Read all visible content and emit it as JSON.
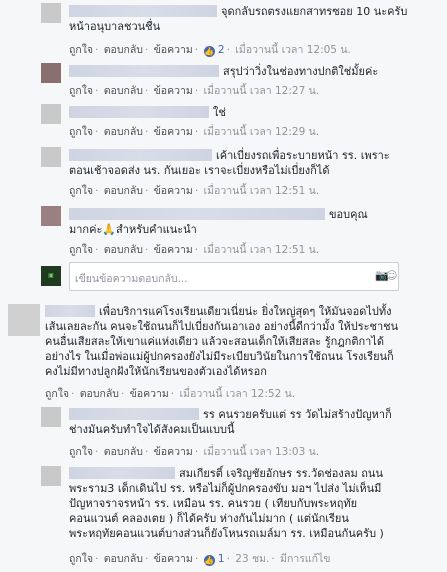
{
  "comments": [
    {
      "line1": "จุดกลับรถตรงแยกสาทรซอย 10 นะครับ",
      "line2": "หน้าอนุบาลชวนชื่น",
      "time": "เมื่อวานนี้ เวลา 12:05 น.",
      "likes": "2"
    },
    {
      "line1": "สรุปว่าวิ่งในช่องทางปกติใช่มั้ยค่ะ",
      "time": "เมื่อวานนี้ เวลา 12:27 น."
    },
    {
      "line1": "ใช่",
      "time": "เมื่อวานนี้ เวลา 12:29 น."
    },
    {
      "line1": "เค้าเบี่ยงรถเพื่อระบายหน้า รร. เพราะ",
      "line2": "ตอนเช้าจอดส่ง นร. กันเยอะ เราจะเบี่ยงหรือไม่เบี่ยงก็ได้",
      "time": "เมื่อวานนี้ เวลา 12:51 น."
    },
    {
      "line1": "ขอบคุณ",
      "line2": "มากค่ะ🙏สำหรับคำแนะนำ",
      "time": "เมื่อวานนี้ เวลา 12:51 น."
    }
  ],
  "composer": {
    "placeholder": "เขียนข้อความตอบกลับ..."
  },
  "main_comment": {
    "lines": [
      "เพื่อบริการแค่โรงเรียนเดียวเนี่ยน่ะ ยิ่งใหญ่สุดๆ ให้มันจอดไปทั้ง",
      "เส้นเลยละกัน คนจะใช้ถนนก็ไปเบี่ยงกันเอาเอง อย่างนี้ดีกว่ามั้ง ให้ประชาชน",
      "คนอื่นเสียสละให้เขาแค่แห่งเดียว แล้วจะสอนเด็กให้เสียสละ รู้กฎกติกาได้",
      "อย่างไร ในเมื่อพ่อแม่ผู้ปกครองยังไม่มีระเบียบวินัยในการใช้ถนน โรงเรียนก็",
      "คงไม่มีทางปลูกฝังให้นักเรียนของตัวเองได้หรอก"
    ],
    "time": "เมื่อวานนี้ เวลา 12:52 น."
  },
  "replies2": [
    {
      "line1": "รร คนรวยครับแต่ รร วัดไม่สร้างปัญหาก็",
      "line2": "ช่างมันครับทำใจได้สังคมเป็นแบบนี้",
      "time": "เมื่อวานนี้ เวลา 13:03 น."
    },
    {
      "lines": [
        "สมเกียรติ์ เจริญชัยอักษร รร.วัดช่องลม ถนน",
        "พระราม3 เด็กเดินไป รร. หรือไม่ก็ผู้ปกครองขับ มอฯ ไปส่ง ไม่เห็นมี",
        "ปัญหาจราจรหน้า รร. เหมือน รร. คนรวย ( เทียบกับพระหฤทัย",
        "คอนแวนต์ คลองเตย ) ก็ได้ครับ ห่างกันไม่มาก ( แต่นักเรียน",
        "พระหฤทัยคอนแวนต์บางส่วนก็ยังโหนรถเมล์มา รร. เหมือนกันครับ )"
      ],
      "time": "23 ชม.",
      "likes": "1",
      "edited": "มีการแก้ไข"
    }
  ],
  "labels": {
    "like": "ถูกใจ",
    "reply": "ตอบกลับ",
    "message": "ข้อความ"
  }
}
